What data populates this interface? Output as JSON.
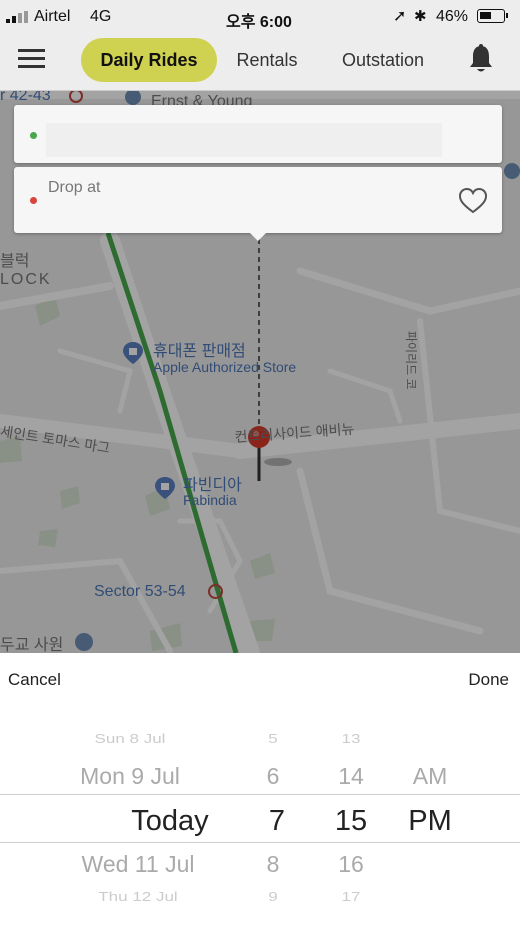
{
  "status_bar": {
    "carrier": "Airtel",
    "network": "4G",
    "time": "오후 6:00",
    "battery": "46%"
  },
  "nav": {
    "menu_icon": "hamburger-menu-icon",
    "tabs": [
      {
        "label": "Daily Rides",
        "active": true
      },
      {
        "label": "Rentals",
        "active": false
      },
      {
        "label": "Outstation",
        "active": false
      }
    ],
    "bell_icon": "bell-icon",
    "accent": "#cfd150"
  },
  "pickup": {
    "value": ""
  },
  "drop": {
    "label": "Drop at"
  },
  "map": {
    "labels": {
      "sector_top": "r 42-43",
      "ernst": "Ernst & Young",
      "block_kr": "블럭",
      "block_en": "LOCK",
      "phone_store_kr": "휴대폰 판매점",
      "apple_store": "Apple Authorized Store",
      "thomas_kr": "세인트 토마스 마그",
      "riverside_kr": "컨트리사이드 애비뉴",
      "fabindia_kr": "파빈디아",
      "fabindia": "Fabindia",
      "sector_53": "Sector 53-54",
      "kyosa_kr": "두교 사원",
      "vertical_kr": "파이리드 코"
    }
  },
  "picker": {
    "cancel_label": "Cancel",
    "done_label": "Done",
    "days": [
      "Sun 8 Jul",
      "Mon 9 Jul",
      "Today",
      "Wed 11 Jul",
      "Thu 12 Jul"
    ],
    "hours": [
      "5",
      "6",
      "7",
      "8",
      "9"
    ],
    "minutes": [
      "13",
      "14",
      "15",
      "16",
      "17"
    ],
    "ampm": [
      "AM",
      "PM"
    ]
  }
}
